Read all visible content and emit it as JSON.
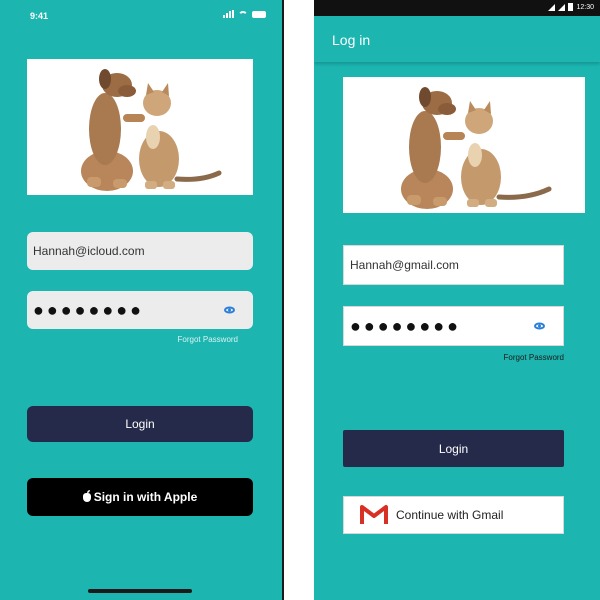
{
  "ios": {
    "status_time": "9:41",
    "email_value": "Hannah@icloud.com",
    "password_mask": "●●●●●●●●",
    "forgot_label": "Forgot Password",
    "login_label": "Login",
    "apple_label": "Sign in with Apple"
  },
  "android": {
    "status_time": "12:30",
    "title": "Log in",
    "email_value": "Hannah@gmail.com",
    "password_mask": "●●●●●●●●",
    "forgot_label": "Forgot Password",
    "login_label": "Login",
    "gmail_label": "Continue with Gmail"
  },
  "colors": {
    "teal": "#1cb5b0",
    "navy_button": "#262a4a",
    "black": "#000000",
    "eye_blue": "#2b7fd9",
    "gmail_red": "#d93025"
  },
  "icons": [
    "signal-icon",
    "wifi-icon",
    "battery-icon",
    "eye-icon",
    "apple-icon",
    "gmail-icon"
  ]
}
